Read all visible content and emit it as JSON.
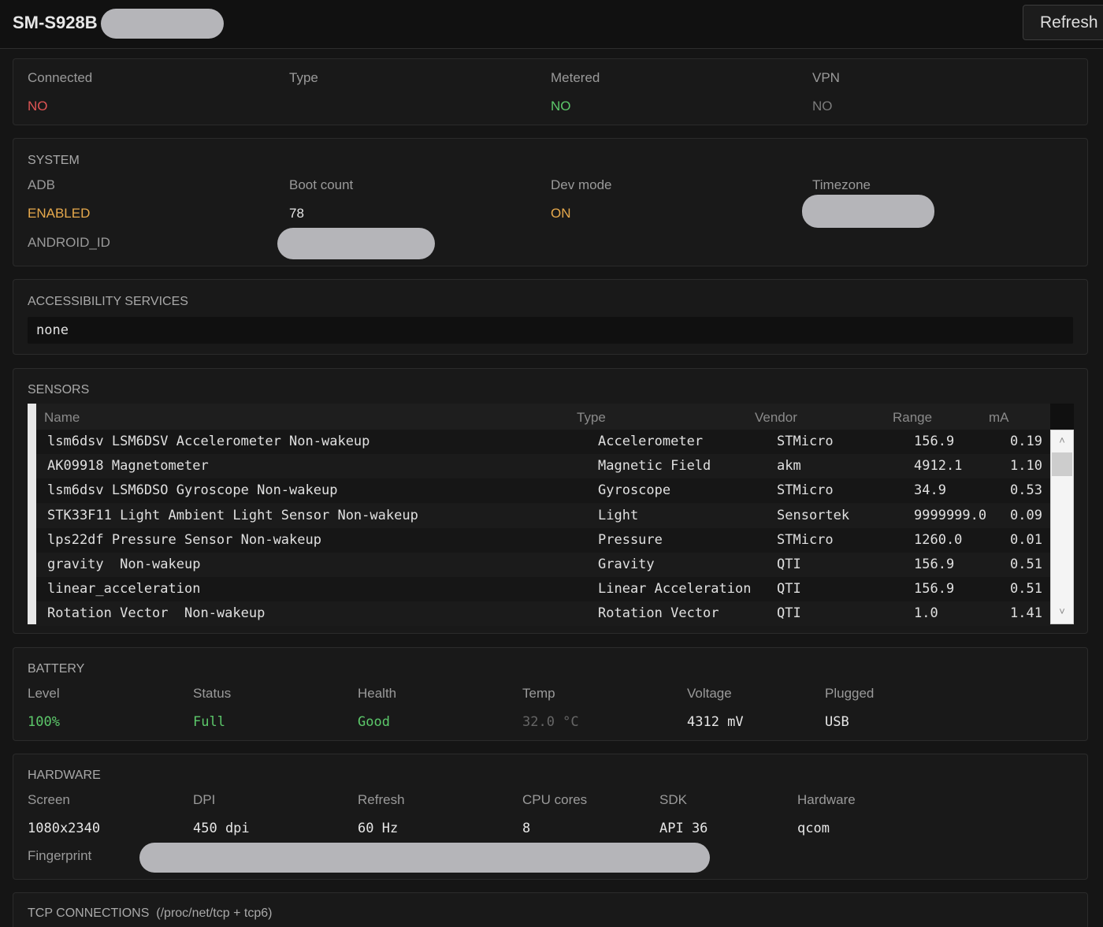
{
  "header": {
    "device_name": "SM-S928B",
    "refresh_label": "Refresh"
  },
  "network": {
    "connected_label": "Connected",
    "connected_value": "NO",
    "type_label": "Type",
    "type_value": "",
    "metered_label": "Metered",
    "metered_value": "NO",
    "vpn_label": "VPN",
    "vpn_value": "NO"
  },
  "system": {
    "title": "SYSTEM",
    "adb_label": "ADB",
    "adb_value": "ENABLED",
    "boot_label": "Boot count",
    "boot_value": "78",
    "dev_label": "Dev mode",
    "dev_value": "ON",
    "tz_label": "Timezone",
    "android_id_label": "ANDROID_ID"
  },
  "accessibility": {
    "title": "ACCESSIBILITY SERVICES",
    "value": "none"
  },
  "sensors": {
    "title": "SENSORS",
    "columns": [
      "Name",
      "Type",
      "Vendor",
      "Range",
      "mA"
    ],
    "rows": [
      [
        "lsm6dsv LSM6DSV Accelerometer Non-wakeup",
        "Accelerometer",
        "STMicro",
        "156.9",
        "0.19"
      ],
      [
        "AK09918 Magnetometer",
        "Magnetic Field",
        "akm",
        "4912.1",
        "1.10"
      ],
      [
        "lsm6dsv LSM6DSO Gyroscope Non-wakeup",
        "Gyroscope",
        "STMicro",
        "34.9",
        "0.53"
      ],
      [
        "STK33F11 Light Ambient Light Sensor Non-wakeup",
        "Light",
        "Sensortek",
        "9999999.0",
        "0.09"
      ],
      [
        "lps22df Pressure Sensor Non-wakeup",
        "Pressure",
        "STMicro",
        "1260.0",
        "0.01"
      ],
      [
        "gravity  Non-wakeup",
        "Gravity",
        "QTI",
        "156.9",
        "0.51"
      ],
      [
        "linear_acceleration",
        "Linear Acceleration",
        "QTI",
        "156.9",
        "0.51"
      ],
      [
        "Rotation Vector  Non-wakeup",
        "Rotation Vector",
        "QTI",
        "1.0",
        "1.41"
      ]
    ],
    "scroll_up_icon": "chevron-up-icon",
    "scroll_down_icon": "chevron-down-icon"
  },
  "battery": {
    "title": "BATTERY",
    "level_label": "Level",
    "level_value": "100%",
    "status_label": "Status",
    "status_value": "Full",
    "health_label": "Health",
    "health_value": "Good",
    "temp_label": "Temp",
    "temp_value": "32.0 °C",
    "voltage_label": "Voltage",
    "voltage_value": "4312 mV",
    "plugged_label": "Plugged",
    "plugged_value": "USB"
  },
  "hardware": {
    "title": "HARDWARE",
    "screen_label": "Screen",
    "screen_value": "1080x2340",
    "dpi_label": "DPI",
    "dpi_value": "450 dpi",
    "refresh_label": "Refresh",
    "refresh_value": "60 Hz",
    "cpu_label": "CPU cores",
    "cpu_value": "8",
    "sdk_label": "SDK",
    "sdk_value": "API 36",
    "hw_label": "Hardware",
    "hw_value": "qcom",
    "fingerprint_label": "Fingerprint"
  },
  "tcp": {
    "title": "TCP CONNECTIONS  (/proc/net/tcp + tcp6)"
  },
  "colors": {
    "red": "#e05555",
    "green": "#5cc86a",
    "orange": "#e6a94c",
    "grey": "#7c7c7c"
  }
}
